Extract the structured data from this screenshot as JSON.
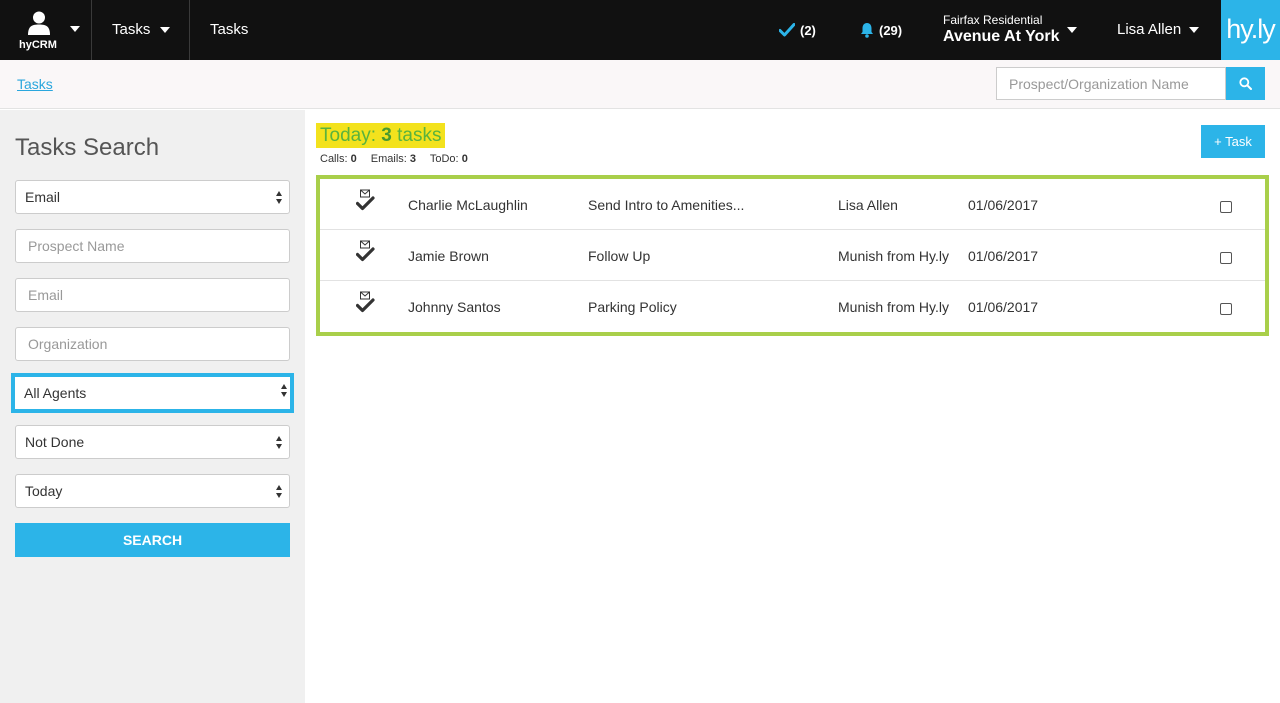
{
  "nav": {
    "brand_name": "hyCRM",
    "tasks_menu_label": "Tasks",
    "tasks_link_label": "Tasks",
    "completed_count": "(2)",
    "notification_count": "(29)",
    "property_org": "Fairfax Residential",
    "property_name": "Avenue At York",
    "user_name": "Lisa Allen",
    "logo_text": "hy.ly"
  },
  "breadcrumb": {
    "label": "Tasks"
  },
  "top_search": {
    "placeholder": "Prospect/Organization Name"
  },
  "sidebar": {
    "title": "Tasks Search",
    "type_select": "Email",
    "prospect_placeholder": "Prospect Name",
    "email_placeholder": "Email",
    "organization_placeholder": "Organization",
    "agent_select": "All Agents",
    "status_select": "Not Done",
    "date_select": "Today",
    "search_label": "SEARCH"
  },
  "summary": {
    "prefix": "Today:",
    "count": "3",
    "suffix": "tasks",
    "calls_label": "Calls:",
    "calls_value": "0",
    "emails_label": "Emails:",
    "emails_value": "3",
    "todo_label": "ToDo:",
    "todo_value": "0"
  },
  "add_task_label": "+ Task",
  "tasks": [
    {
      "name": "Charlie McLaughlin",
      "subject": "Send Intro to Amenities...",
      "agent": "Lisa Allen",
      "date": "01/06/2017"
    },
    {
      "name": "Jamie Brown",
      "subject": "Follow Up",
      "agent": "Munish from Hy.ly",
      "date": "01/06/2017"
    },
    {
      "name": "Johnny Santos",
      "subject": "Parking Policy",
      "agent": "Munish from Hy.ly",
      "date": "01/06/2017"
    }
  ],
  "colors": {
    "accent": "#2cb4e8",
    "highlight_yellow": "#f3e21d",
    "highlight_green_text": "#5ab33d",
    "task_box_border": "#a9cf4a",
    "topbar": "#111111"
  },
  "icons": {
    "brand": "user-icon",
    "completed": "checkmark-icon",
    "notifications": "bell-icon",
    "search": "search-icon",
    "task_type": "email-done-icon"
  }
}
